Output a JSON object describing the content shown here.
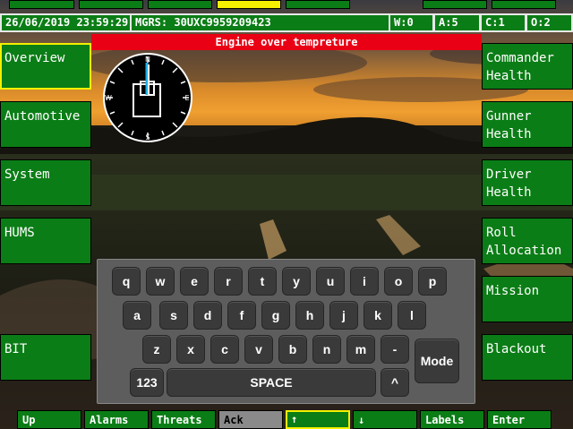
{
  "colors": {
    "button_green": "#0b7d16",
    "selected_border": "#f5ef00",
    "alert_red": "#e90014",
    "ack_grey": "#8a8a8a",
    "keyboard_bg": "#5d5d5d",
    "key_bg": "#3a3a3a"
  },
  "status": {
    "datetime": "26/06/2019 23:59:29",
    "mgrs": "MGRS: 30UXC9959209423",
    "w": "W:0",
    "a": "A:5",
    "c": "C:1",
    "o": "O:2"
  },
  "alert": "Engine over tempreture",
  "compass": {
    "n": "N",
    "e": "E",
    "s": "S",
    "w": "W"
  },
  "left_menu": [
    "Overview",
    "Automotive",
    "System",
    "HUMS",
    "BIT"
  ],
  "right_menu": [
    "Commander Health",
    "Gunner Health",
    "Driver Health",
    "Roll Allocation",
    "Mission",
    "Blackout"
  ],
  "keyboard": {
    "row1": [
      "q",
      "w",
      "e",
      "r",
      "t",
      "y",
      "u",
      "i",
      "o",
      "p"
    ],
    "row2": [
      "a",
      "s",
      "d",
      "f",
      "g",
      "h",
      "j",
      "k",
      "l"
    ],
    "row3": [
      "z",
      "x",
      "c",
      "v",
      "b",
      "n",
      "m",
      "-"
    ],
    "mode": "Mode",
    "numbers": "123",
    "space": "SPACE",
    "caret": "^"
  },
  "bottom_bar": [
    "Up",
    "Alarms",
    "Threats",
    "Ack",
    "↑",
    "↓",
    "Labels",
    "Enter"
  ]
}
